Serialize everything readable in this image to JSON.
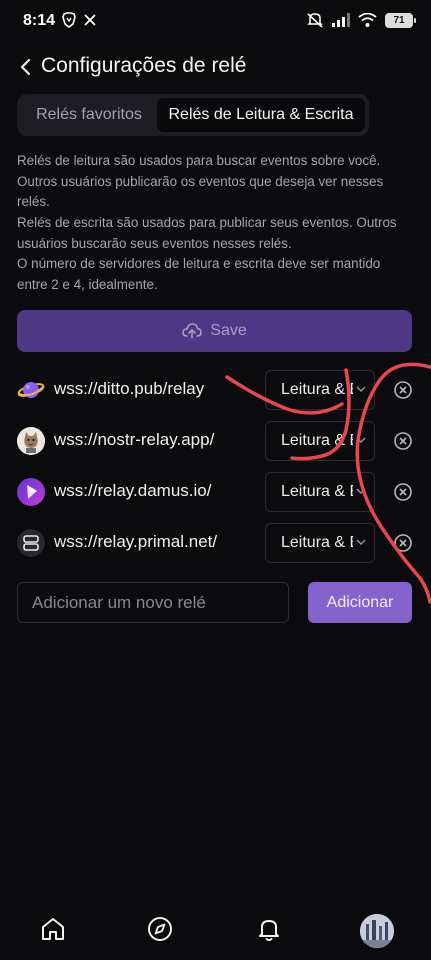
{
  "status_bar": {
    "time": "8:14",
    "battery": "71"
  },
  "header": {
    "title": "Configurações de relé"
  },
  "tabs": [
    {
      "label": "Relés favoritos",
      "active": false
    },
    {
      "label": "Relés de Leitura & Escrita",
      "active": true
    }
  ],
  "descriptions": {
    "read": "Relés de leitura são usados para buscar eventos sobre você. Outros usuários publicarão os eventos que deseja ver nesses relés.",
    "write": "Relés de escrita são usados para publicar seus eventos. Outros usuários buscarão seus eventos nesses relés.",
    "count": "O número de servidores de leitura e escrita deve ser mantido entre 2 e 4, idealmente."
  },
  "save_button": {
    "label": "Save"
  },
  "relays": [
    {
      "url": "wss://ditto.pub/relay",
      "mode": "Leitura & Escrita",
      "icon": "planet-icon"
    },
    {
      "url": "wss://nostr-relay.app/",
      "mode": "Leitura & Escrita",
      "icon": "cat-avatar-icon"
    },
    {
      "url": "wss://relay.damus.io/",
      "mode": "Leitura & Escrita",
      "icon": "damus-icon"
    },
    {
      "url": "wss://relay.primal.net/",
      "mode": "Leitura & Escrita",
      "icon": "server-icon"
    }
  ],
  "add_relay": {
    "placeholder": "Adicionar um novo relé",
    "button_label": "Adicionar"
  },
  "colors": {
    "accent": "#8463cd",
    "save_disabled": "#4d3886",
    "background": "#0b0a0d",
    "scribble": "#e8484b"
  }
}
